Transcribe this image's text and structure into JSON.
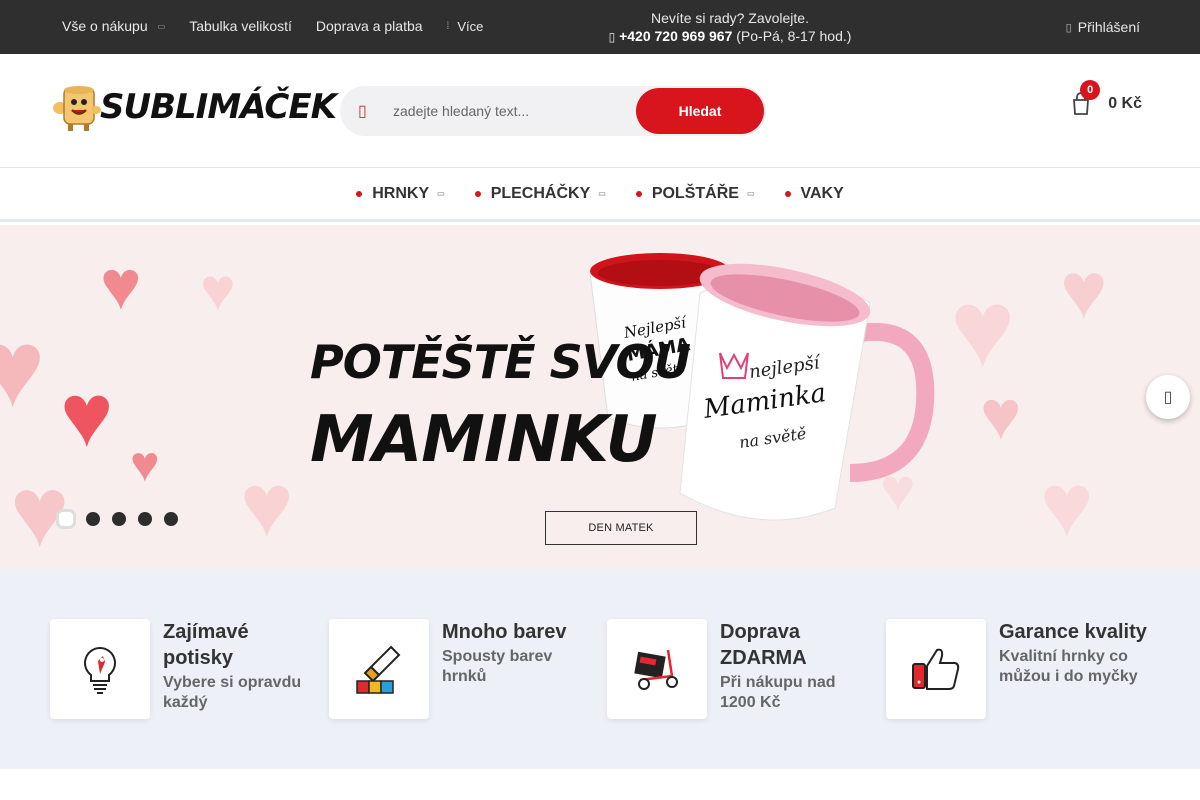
{
  "topbar": {
    "nav": [
      {
        "label": "Vše o nákupu",
        "has_dropdown": true
      },
      {
        "label": "Tabulka velikostí",
        "has_dropdown": false
      },
      {
        "label": "Doprava a platba",
        "has_dropdown": false
      }
    ],
    "more_label": "Více",
    "contact": {
      "line1": "Nevíte si rady? Zavolejte.",
      "phone": "+420 720 969 967",
      "hours": "(Po-Pá, 8-17 hod.)"
    },
    "login_label": "Přihlášení"
  },
  "header": {
    "logo_text": "SUBLIMÁČEK",
    "search": {
      "placeholder": "zadejte hledaný text...",
      "button_label": "Hledat"
    },
    "cart": {
      "count": "0",
      "price": "0 Kč"
    }
  },
  "categories": [
    {
      "label": "HRNKY",
      "has_dropdown": true
    },
    {
      "label": "PLECHÁČKY",
      "has_dropdown": true
    },
    {
      "label": "POLŠTÁŘE",
      "has_dropdown": true
    },
    {
      "label": "VAKY",
      "has_dropdown": false
    }
  ],
  "banner": {
    "title_line1": "POTĚŠTĚ SVOU",
    "title_line2": "MAMINKU",
    "cta_label": "DEN MATEK",
    "mug_left_text": [
      "Nejlepší",
      "MÁMA",
      "na světě"
    ],
    "mug_right_text": [
      "nejlepší",
      "Maminka",
      "na světě"
    ],
    "slide_count": 5,
    "active_slide": 1
  },
  "features": [
    {
      "title": "Zajímavé potisky",
      "subtitle": "Vybere si opravdu každý",
      "icon": "lightbulb-icon"
    },
    {
      "title": "Mnoho barev",
      "subtitle": "Spousty barev hrnků",
      "icon": "color-picker-icon"
    },
    {
      "title": "Doprava ZDARMA",
      "subtitle": "Při nákupu nad 1200 Kč",
      "icon": "delivery-cart-icon"
    },
    {
      "title": "Garance kvality",
      "subtitle": "Kvalitní hrnky co můžou i do myčky",
      "icon": "thumbs-up-icon"
    }
  ],
  "colors": {
    "accent": "#d8141c",
    "topbar": "#2f2f2f",
    "features_bg": "#eef0f7"
  }
}
